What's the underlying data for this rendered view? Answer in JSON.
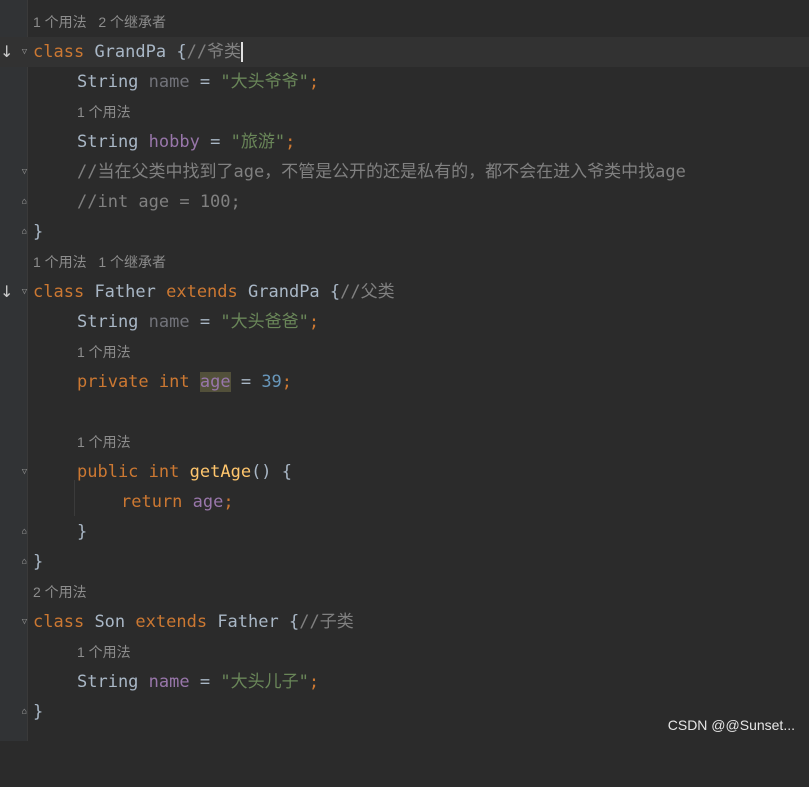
{
  "hints": {
    "h1": "1 个用法   2 个继承者",
    "h2": "1 个用法",
    "h3": "1 个用法   1 个继承者",
    "h4": "1 个用法",
    "h5": "1 个用法",
    "h6": "2 个用法",
    "h7": "1 个用法"
  },
  "code": {
    "kw_class": "class",
    "kw_extends": "extends",
    "kw_private": "private",
    "kw_int": "int",
    "kw_public": "public",
    "kw_return": "return",
    "type_string": "String",
    "cls_grandpa": "GrandPa",
    "cls_father": "Father",
    "cls_son": "Son",
    "brace_open": " {",
    "brace_close": "}",
    "inner_close": "}",
    "assign": " = ",
    "semicolon": ";",
    "fld_name": "name",
    "fld_hobby": "hobby",
    "fld_age": "age",
    "fn_getage": "getAge",
    "fn_parens": "() {",
    "cmt_grandpa": "//爷类",
    "cmt_father": "//父类",
    "cmt_son": "//子类",
    "cmt_line1": "//当在父类中找到了age，不管是公开的还是私有的，都不会在进入爷类中找age",
    "cmt_line2": "//int age = 100;",
    "str_grandpa_name": "\"大头爷爷\"",
    "str_hobby": "\"旅游\"",
    "str_father_name": "\"大头爸爸\"",
    "str_son_name": "\"大头儿子\"",
    "num_39": "39"
  },
  "icons": {
    "override_arrow": "↓",
    "fold_marker": "▽",
    "fold_end": "⌂"
  },
  "watermark": "CSDN @@Sunset..."
}
